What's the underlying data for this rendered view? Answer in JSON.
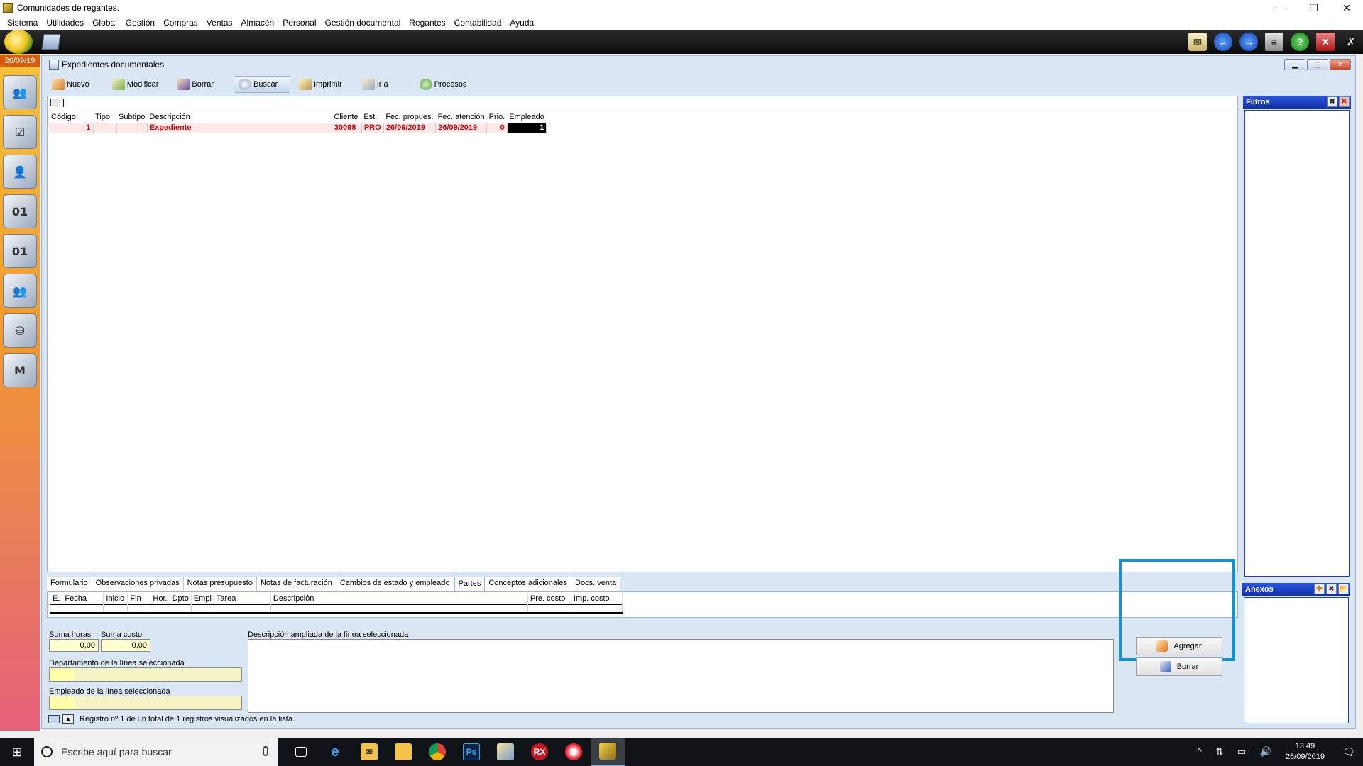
{
  "window": {
    "title": "Comunidades de regantes.",
    "controls": [
      "—",
      "❐",
      "✕"
    ]
  },
  "menu": [
    "Sistema",
    "Utilidades",
    "Global",
    "Gestión",
    "Compras",
    "Ventas",
    "Almacén",
    "Personal",
    "Gestión documental",
    "Regantes",
    "Contabilidad",
    "Ayuda"
  ],
  "topbar": {
    "icons": [
      "mail-icon",
      "back-arrow-icon",
      "forward-arrow-icon",
      "list-icon",
      "help-icon",
      "close-icon",
      "exit-icon"
    ]
  },
  "sidebar": {
    "date": "26/09/19",
    "modules": [
      "users-icon",
      "tasks-icon",
      "person-icon",
      "db-01-icon",
      "db-01b-icon",
      "contacts-icon",
      "database-tools-icon",
      "mx-icon"
    ]
  },
  "subwindow": {
    "title": "Expedientes documentales"
  },
  "actions": {
    "nuevo": "Nuevo",
    "modificar": "Modificar",
    "borrar": "Borrar",
    "buscar": "Buscar",
    "imprimir": "Imprimir",
    "ira": "Ir a",
    "procesos": "Procesos"
  },
  "grid": {
    "headers": {
      "codigo": "Código",
      "tipo": "Tipo",
      "subtipo": "Subtipo",
      "descripcion": "Descripción",
      "cliente": "Cliente",
      "est": "Est.",
      "fec_prop": "Fec. propues.",
      "fec_aten": "Fec. atención",
      "prio": "Prio.",
      "empleado": "Empleado"
    },
    "rows": [
      {
        "codigo": "1",
        "tipo": "",
        "subtipo": "",
        "descripcion": "Expediente",
        "cliente": "30098",
        "est": "PRO",
        "fec_prop": "26/09/2019",
        "fec_aten": "26/09/2019",
        "prio": "0",
        "empleado": "1"
      }
    ]
  },
  "filtros": {
    "title": "Filtros"
  },
  "anexos": {
    "title": "Anexos"
  },
  "tabs": [
    "Formulario",
    "Observaciones privadas",
    "Notas presupuesto",
    "Notas de facturación",
    "Cambios de estado y empleado",
    "Partes",
    "Conceptos adicionales",
    "Docs. venta"
  ],
  "active_tab": "Partes",
  "lines_grid": {
    "headers": {
      "e": "E.",
      "fecha": "Fecha",
      "inicio": "Inicio",
      "fin": "Fin",
      "hor": "Hor.",
      "dpto": "Dpto",
      "empl": "Empl",
      "tarea": "Tarea",
      "descripcion": "Descripción",
      "pre_costo": "Pre. costo",
      "imp_costo": "Imp. costo"
    }
  },
  "summary": {
    "suma_horas_label": "Suma horas",
    "suma_horas": "0,00",
    "suma_costo_label": "Suma costo",
    "suma_costo": "0,00",
    "dpto_label": "Departamento de la línea seleccionada",
    "empl_label": "Empleado de la línea seleccionada",
    "desc_label": "Descripción ampliada de la línea seleccionada"
  },
  "side_actions": {
    "agregar": "Agregar",
    "borrar": "Borrar"
  },
  "status": {
    "text": "Registro nº 1 de un total de 1 registros visualizados en la lista."
  },
  "taskbar": {
    "search_placeholder": "Escribe aquí para buscar",
    "apps": [
      "task-view-icon",
      "edge-icon",
      "mail-folder-icon",
      "file-explorer-icon",
      "chrome-icon",
      "photoshop-icon",
      "app-doc-icon",
      "rx-icon",
      "firefox-like-icon",
      "regantes-app-icon"
    ],
    "time": "13:49",
    "date": "26/09/2019"
  }
}
